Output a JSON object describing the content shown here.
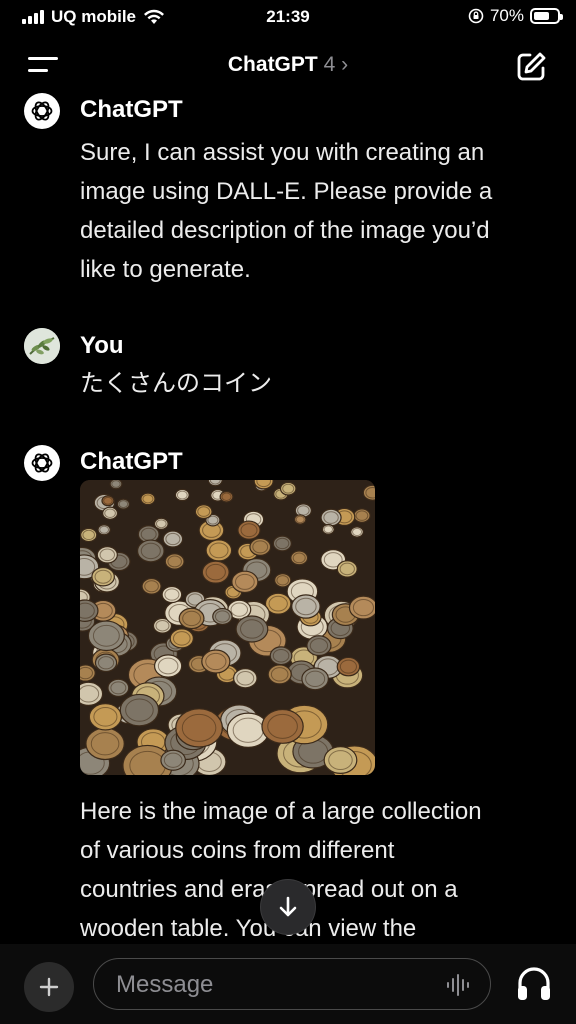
{
  "status_bar": {
    "carrier": "UQ mobile",
    "time": "21:39",
    "battery_percent": "70%",
    "battery_level": 0.7
  },
  "header": {
    "title": "ChatGPT",
    "version": "4",
    "chevron": "›",
    "menu_icon": "menu-icon",
    "new_chat_icon": "edit-icon"
  },
  "messages": [
    {
      "sender": "ChatGPT",
      "lines": [
        "Sure, I can assist you with creating an",
        "image using DALL-E. Please provide a",
        "detailed description of the image you’d",
        "like to generate."
      ]
    },
    {
      "sender": "You",
      "text": "たくさんのコイン"
    },
    {
      "sender": "ChatGPT",
      "image": "coins-image",
      "lines": [
        "Here is the image of a large collection",
        "of various coins from different",
        "countries and eras, spread out on a",
        "wooden table. You can view the"
      ]
    }
  ],
  "composer": {
    "placeholder": "Message",
    "add_icon": "plus-icon",
    "voice_icon": "waveform-icon",
    "headphones_icon": "headphones-icon"
  },
  "colors": {
    "background": "#000000",
    "text": "#ececec",
    "muted": "#8e8e93"
  }
}
